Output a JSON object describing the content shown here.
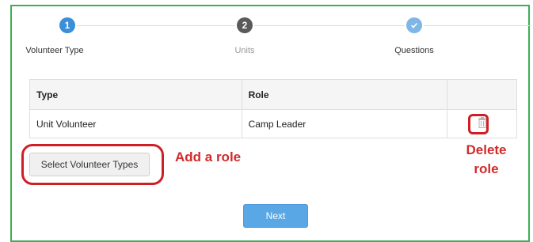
{
  "stepper": {
    "steps": [
      {
        "number": "1",
        "label": "Volunteer Type",
        "state": "active",
        "color": "#3a8fd8"
      },
      {
        "number": "2",
        "label": "Units",
        "state": "pending",
        "color": "#5a5a5a"
      },
      {
        "number": "",
        "label": "Questions",
        "state": "complete",
        "color": "#7fb6e8",
        "icon": "checkmark-icon"
      }
    ]
  },
  "roles_table": {
    "headers": [
      "Type",
      "Role",
      ""
    ],
    "rows": [
      {
        "type": "Unit Volunteer",
        "role": "Camp Leader",
        "action_icon": "trash-icon"
      }
    ]
  },
  "buttons": {
    "select_volunteer_types": "Select Volunteer Types",
    "next": "Next"
  },
  "annotations": {
    "add_role": "Add a role",
    "delete_role_line1": "Delete",
    "delete_role_line2": "role",
    "color": "#cf1f26"
  },
  "colors": {
    "frame_border": "#3eae57",
    "primary": "#5aa7e6"
  }
}
